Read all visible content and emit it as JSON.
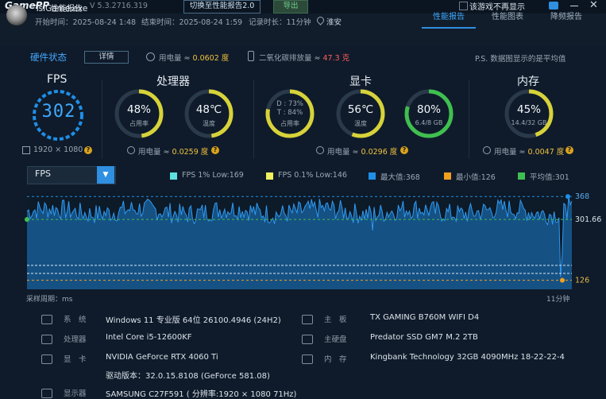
{
  "titlebar": {
    "logo": "GamePP",
    "title": "性能报告",
    "version": "V 5.3.2716.319",
    "switch_button": "切换至性能报告2.0",
    "export_button": "导出",
    "no_show_label": "该游戏不再显示"
  },
  "header": {
    "game_name": "TslGame.exe",
    "start_time": "开始时间：2025-08-24 1:48",
    "end_time": "结束时间：2025-08-24 1:59",
    "duration": "记录时长：11分钟",
    "location": "淮安",
    "tabs": [
      {
        "label": "性能报告",
        "active": true
      },
      {
        "label": "性能图表",
        "active": false
      },
      {
        "label": "降频报告",
        "active": false
      }
    ]
  },
  "hardware": {
    "title": "硬件状态",
    "detail_button": "详情",
    "power_label": "用电量 ≈ ",
    "power_value": "0.0602 度",
    "co2_label": "二氧化碳排放量 ≈ ",
    "co2_value": "47.3 克",
    "note": "P.S. 数据图显示的是平均值"
  },
  "fps": {
    "title": "FPS",
    "value": "302",
    "resolution": "1920 × 1080"
  },
  "cpu": {
    "title": "处理器",
    "usage_value": "48%",
    "usage_label": "占用率",
    "usage_level": 0.48,
    "temp_value": "48℃",
    "temp_label": "温度",
    "temp_level": 0.48,
    "power_label": "用电量 ≈ ",
    "power_value": "0.0259 度"
  },
  "gpu": {
    "title": "显卡",
    "d_line": "D : 73%",
    "t_line": "T : 84%",
    "usage_label": "占用率",
    "temp_value": "56℃",
    "temp_label": "温度",
    "temp_level": 0.56,
    "vram_value": "80%",
    "vram_sub": "6.4/8 GB",
    "vram_level": 0.8,
    "power_label": "用电量 ≈ ",
    "power_value": "0.0296 度"
  },
  "memory": {
    "title": "内存",
    "usage_value": "45%",
    "usage_sub": "14.4/32 GB",
    "usage_level": 0.45,
    "power_label": "用电量 ≈ ",
    "power_value": "0.0047 度"
  },
  "chart_controls": {
    "metric_select": "FPS",
    "legend": [
      {
        "label": "FPS 1% Low:169",
        "color": "#5fe0e0"
      },
      {
        "label": "FPS 0.1% Low:146",
        "color": "#f0f060"
      },
      {
        "label": "最大值:368",
        "color": "#1f8fe8"
      },
      {
        "label": "最小值:126",
        "color": "#f0a020"
      },
      {
        "label": "平均值:301",
        "color": "#3fbf4f"
      }
    ]
  },
  "chart_data": {
    "type": "area",
    "series": [
      {
        "name": "FPS",
        "summary": {
          "max": 368,
          "min": 126,
          "avg": 301.66,
          "low_1pct": 169,
          "low_01pct": 146
        }
      }
    ],
    "y_tick_labels": [
      "368",
      "301.66",
      "126"
    ],
    "ylim": [
      100,
      380
    ],
    "x_start_label": "采样周期：ms",
    "x_end_label": "11分钟",
    "grid": false
  },
  "specs": [
    {
      "label": "系　统",
      "value": "Windows 11 专业版 64位 26100.4946 (24H2)"
    },
    {
      "label": "处理器",
      "value": "Intel Core i5-12600KF"
    },
    {
      "label": "显　卡",
      "value": "NVIDIA GeForce RTX 4060 Ti"
    },
    {
      "label": "",
      "value": "驱动版本：32.0.15.8108 (GeForce 581.08)"
    },
    {
      "label": "显示器",
      "value": "SAMSUNG C27F591 ( 分辨率:1920 × 1080 71Hz)"
    },
    {
      "label": "主　板",
      "value": "TX GAMING B760M WIFI D4"
    },
    {
      "label": "主硬盘",
      "value": "Predator SSD GM7 M.2 2TB"
    },
    {
      "label": "内　存",
      "value": "Kingbank Technology 32GB 4090MHz 18-22-22-4"
    }
  ],
  "colors": {
    "accent": "#2f8fe0",
    "good": "#3fbf4f",
    "warn": "#f0c040",
    "danger": "#ff5d5d"
  }
}
